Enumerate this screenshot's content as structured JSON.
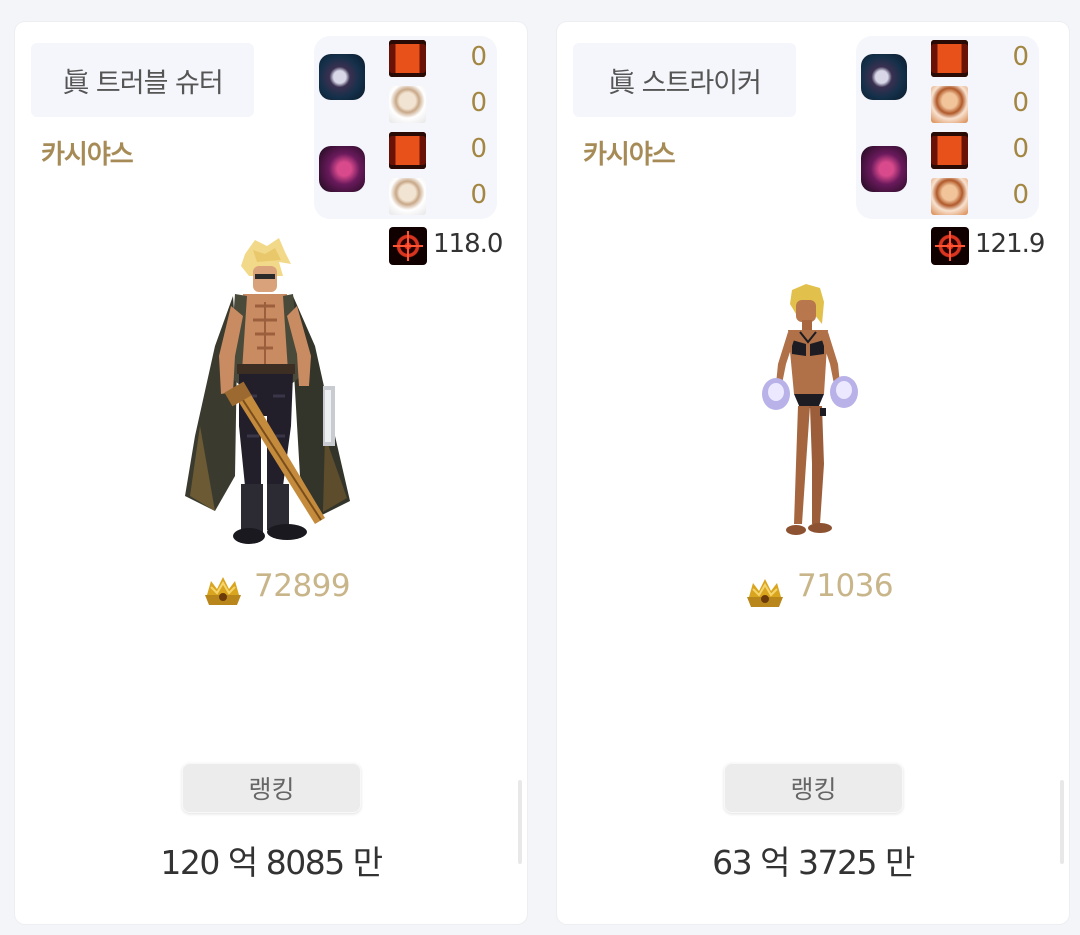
{
  "cards": [
    {
      "job": "眞 트러블 슈터",
      "server": "카시야스",
      "buff_counts": [
        "0",
        "0",
        "0",
        "0"
      ],
      "stat": "118.0",
      "fame": "72899",
      "rank_label": "랭킹",
      "damage": "120 억 8085 만"
    },
    {
      "job": "眞 스트라이커",
      "server": "카시야스",
      "buff_counts": [
        "0",
        "0",
        "0",
        "0"
      ],
      "stat": "121.9",
      "fame": "71036",
      "rank_label": "랭킹",
      "damage": "63 억 3725 만"
    }
  ],
  "icons": {
    "buff_top": "dark-knight-icon",
    "buff_bottom": "crimson-demon-icon",
    "flag": "red-banner-icon",
    "portrait_1": "white-hair-portrait-icon",
    "portrait_2": "brown-hair-portrait-icon",
    "stat": "crosshair-icon",
    "fame": "gold-crown-icon"
  },
  "colors": {
    "server": "#a68b57",
    "buff_count": "#a38642",
    "fame": "#c9b58a"
  }
}
